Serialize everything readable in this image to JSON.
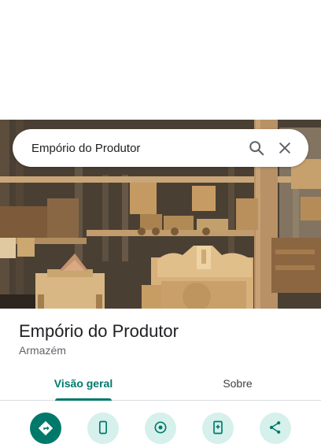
{
  "search": {
    "query": "Empório do Produtor",
    "search_icon": "search-icon",
    "close_icon": "close-icon"
  },
  "photo": {
    "subject": "storefront-photo"
  },
  "place": {
    "name": "Empório do Produtor",
    "category": "Armazém"
  },
  "tabs": [
    {
      "label": "Visão geral",
      "active": true
    },
    {
      "label": "Sobre",
      "active": false
    }
  ],
  "actions": [
    {
      "icon": "directions-icon",
      "primary": true
    },
    {
      "icon": "phone-icon",
      "primary": false
    },
    {
      "icon": "website-icon",
      "primary": false
    },
    {
      "icon": "save-icon",
      "primary": false
    },
    {
      "icon": "share-icon",
      "primary": false
    }
  ],
  "colors": {
    "accent": "#00796b",
    "accent_light": "#d6f0ec",
    "title": "#202124",
    "secondary_text": "#5f6368"
  }
}
